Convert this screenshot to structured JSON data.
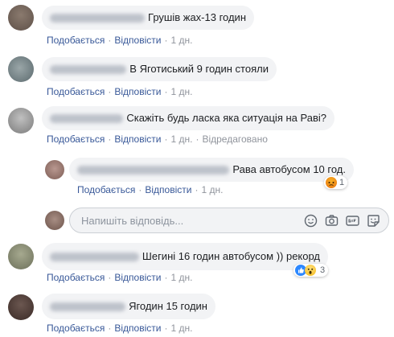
{
  "actions": {
    "like": "Подобається",
    "reply": "Відповісти",
    "edited": "Відредаговано"
  },
  "comments": [
    {
      "text": "Грушів жах-13 годин",
      "time": "1 дн."
    },
    {
      "text": "В Яготиський 9 годин стояли",
      "time": "1 дн."
    },
    {
      "text": "Скажіть будь ласка яка ситуація на Раві?",
      "time": "1 дн."
    },
    {
      "text": "Рава автобусом 10 год.",
      "time": "1 дн.",
      "reaction_count": "1"
    },
    {
      "text": "Шегині 16 годин автобусом )) рекорд",
      "time": "1 дн.",
      "reaction_count": "3"
    },
    {
      "text": "Ягодин 15 годин",
      "time": "1 дн."
    }
  ],
  "reply_box": {
    "placeholder": "Напишіть відповідь..."
  },
  "colors": {
    "link": "#385898",
    "bubble": "#f2f3f5",
    "meta": "#90949c"
  }
}
